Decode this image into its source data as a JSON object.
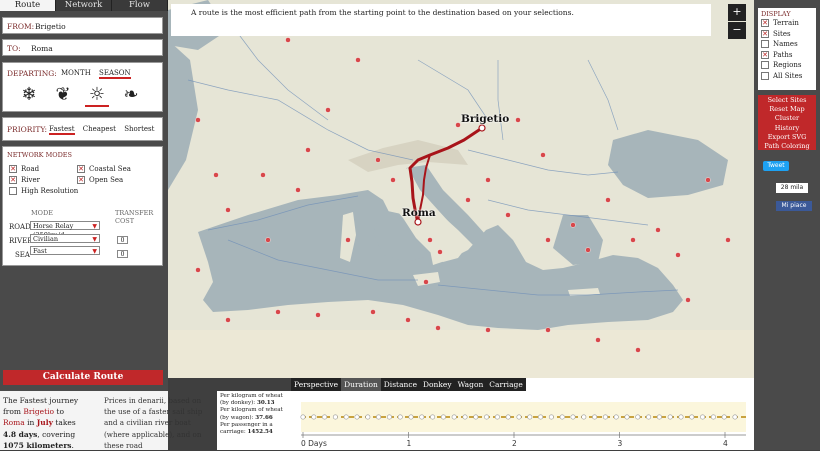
{
  "tabs": [
    {
      "label": "Route",
      "active": true
    },
    {
      "label": "Network",
      "active": false
    },
    {
      "label": "Flow",
      "active": false
    }
  ],
  "from": {
    "label": "FROM:",
    "value": "Brigetio"
  },
  "to": {
    "label": "TO:",
    "value": "Roma"
  },
  "departing": {
    "label": "DEPARTING:",
    "options": [
      "MONTH",
      "SEASON"
    ],
    "selected": "SEASON",
    "seasons": [
      {
        "name": "winter-snowflake-icon",
        "glyph": "❄",
        "selected": false
      },
      {
        "name": "spring-tulip-icon",
        "glyph": "❦",
        "selected": false
      },
      {
        "name": "summer-sun-icon",
        "glyph": "☼",
        "selected": true
      },
      {
        "name": "autumn-leaf-icon",
        "glyph": "❧",
        "selected": false
      }
    ]
  },
  "priority": {
    "label": "PRIORITY:",
    "options": [
      "Fastest",
      "Cheapest",
      "Shortest"
    ],
    "selected": "Fastest"
  },
  "network_modes": {
    "title": "NETWORK MODES",
    "items": [
      {
        "label": "Road",
        "checked": true
      },
      {
        "label": "Coastal Sea",
        "checked": true
      },
      {
        "label": "River",
        "checked": true
      },
      {
        "label": "Open Sea",
        "checked": true
      },
      {
        "label": "High Resolution",
        "checked": false
      }
    ],
    "mode_header": "MODE",
    "transfer_header": "TRANSFER",
    "cost_header": "COST",
    "road_label": "ROAD",
    "river_label": "RIVER",
    "sea_label": "SEA",
    "road_value": "Horse Relay (250km/d",
    "river_value": "Civilian",
    "sea_value": "Fast",
    "transfer_river": "0",
    "transfer_sea": "0"
  },
  "calculate_label": "Calculate Route",
  "map": {
    "info_text": "A route is the most efficient path from the starting point to the destination based on your selections.",
    "zoom_in": "+",
    "zoom_out": "−",
    "origin_label": "Brigetio",
    "destination_label": "Roma",
    "colors": {
      "route": "#a8141a",
      "land": "#e8e7d9",
      "sea": "#a7b5ba",
      "site": "#d8474a"
    }
  },
  "display": {
    "title": "DISPLAY",
    "items": [
      {
        "label": "Terrain",
        "checked": true
      },
      {
        "label": "Sites",
        "checked": true
      },
      {
        "label": "Names",
        "checked": false
      },
      {
        "label": "Paths",
        "checked": true
      },
      {
        "label": "Regions",
        "checked": false
      },
      {
        "label": "All Sites",
        "checked": false
      }
    ]
  },
  "actions": [
    "Select Sites",
    "Reset Map",
    "Cluster",
    "History",
    "Export SVG",
    "Path Coloring"
  ],
  "social": {
    "tweet": "Tweet",
    "likes": "28 mila",
    "fb": "Mi piace"
  },
  "summary": {
    "prefix": "The Fastest journey from ",
    "from": "Brigetio",
    "mid1": " to ",
    "to": "Roma",
    "mid2": " in ",
    "month": "July",
    "mid3": " takes ",
    "days": "4.8 days",
    "mid4": ", covering ",
    "km": "1075 kilometers",
    "suffix": ".",
    "prices_text": "Prices in denarii, based on the use of a faster sail ship and a civilian river boat (where applicable), and on these road"
  },
  "prices": {
    "donkey_label": "Per kilogram of wheat (by donkey):",
    "donkey_value": "30.13",
    "wagon_label": "Per kilogram of wheat (by wagon):",
    "wagon_value": "37.66",
    "carriage_label": "Per passenger in a carriage:",
    "carriage_value": "1452.54"
  },
  "timeline": {
    "buttons": [
      "Perspective",
      "Duration",
      "Distance",
      "Donkey",
      "Wagon",
      "Carriage"
    ],
    "active": "Duration",
    "ticks": [
      "0 Days",
      "1",
      "2",
      "3",
      "4"
    ]
  }
}
